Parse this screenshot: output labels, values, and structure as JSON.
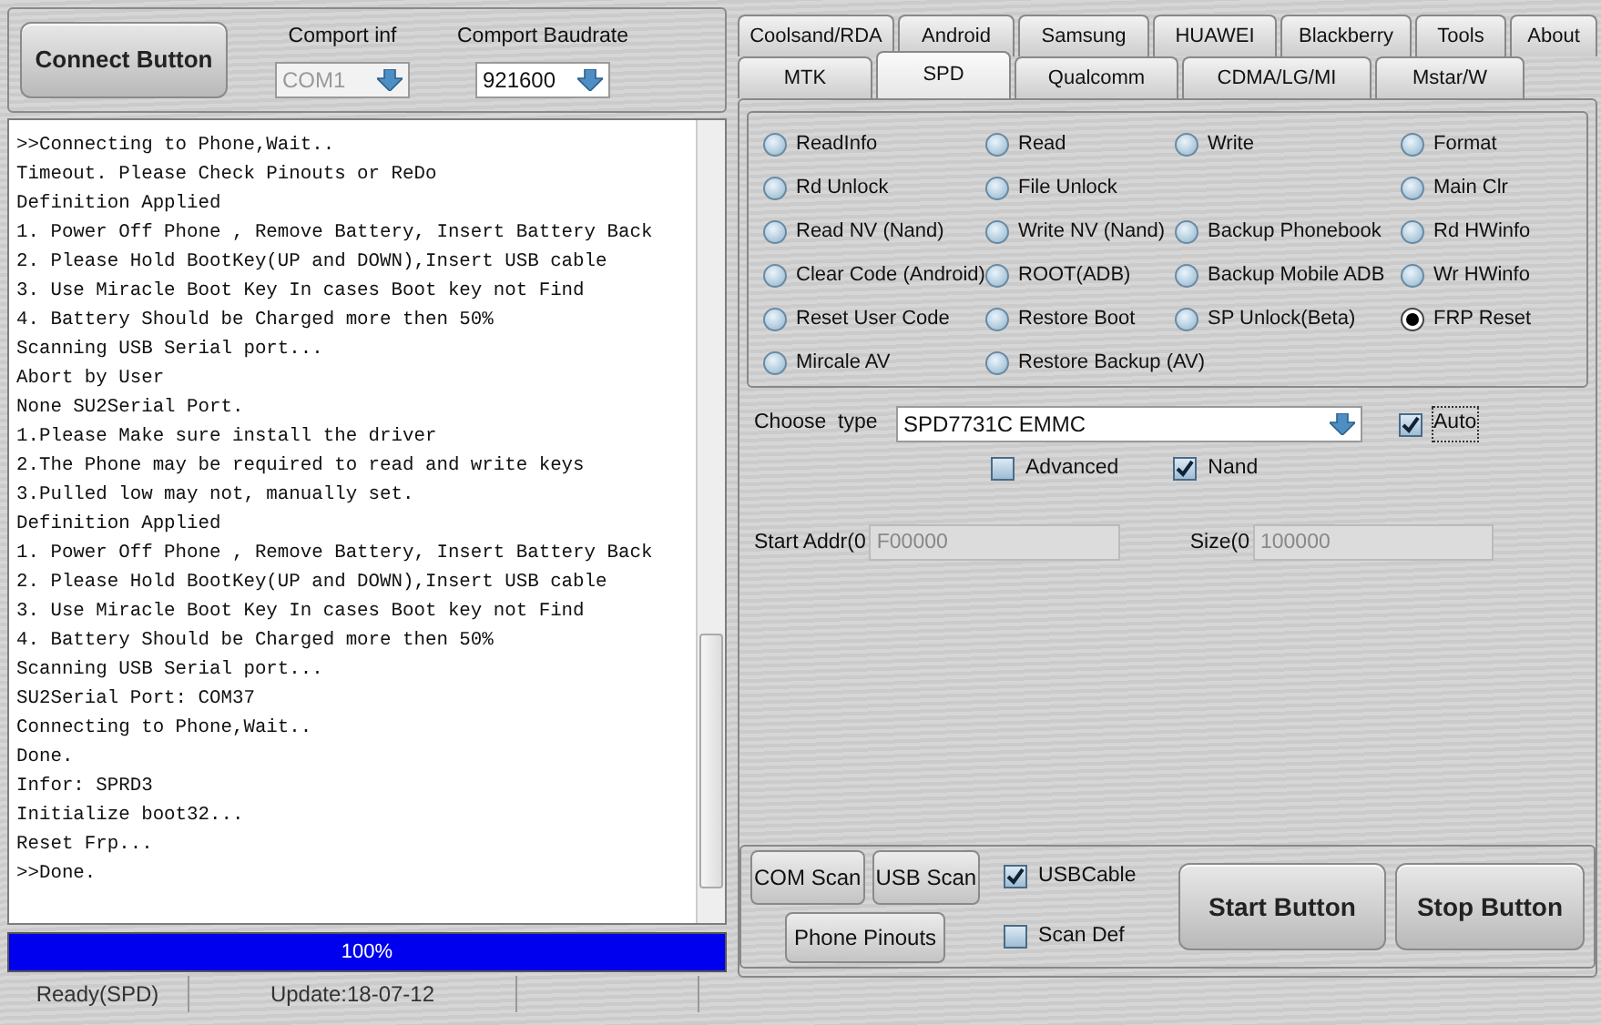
{
  "connect_button": "Connect Button",
  "comport": {
    "label": "Comport inf",
    "value": "COM1",
    "disabled": true
  },
  "baudrate": {
    "label": "Comport Baudrate",
    "value": "921600",
    "disabled": false
  },
  "log": [
    ">>Connecting to Phone,Wait..",
    "Timeout. Please Check Pinouts or ReDo",
    "Definition Applied",
    "1. Power Off Phone , Remove Battery, Insert Battery Back",
    "2. Please Hold BootKey(UP and DOWN),Insert USB cable",
    "3. Use Miracle Boot Key In cases Boot key not Find",
    "4. Battery Should be Charged more then 50%",
    "Scanning USB Serial port...",
    "Abort by User",
    "None SU2Serial Port.",
    "1.Please Make sure install the driver",
    "2.The Phone may be required to read and write keys",
    "3.Pulled low may not, manually set.",
    "Definition Applied",
    "1. Power Off Phone , Remove Battery, Insert Battery Back",
    "2. Please Hold BootKey(UP and DOWN),Insert USB cable",
    "3. Use Miracle Boot Key In cases Boot key not Find",
    "4. Battery Should be Charged more then 50%",
    "Scanning USB Serial port...",
    "SU2Serial Port: COM37",
    "Connecting to Phone,Wait..",
    "Done.",
    "Infor: SPRD3",
    "Initialize boot32...",
    "Reset Frp...",
    ">>Done."
  ],
  "progress": {
    "level": 1.0,
    "reading": "100%"
  },
  "status_bar": [
    "Ready(SPD)",
    "Update:18-07-12"
  ],
  "tab_rows": [
    [
      {
        "label": "Coolsand/RDA",
        "selected": false
      },
      {
        "label": "Android",
        "selected": false
      },
      {
        "label": "Samsung",
        "selected": false
      },
      {
        "label": "HUAWEI",
        "selected": false
      },
      {
        "label": "Blackberry",
        "selected": false
      },
      {
        "label": "Tools",
        "selected": false
      },
      {
        "label": "About",
        "selected": false
      }
    ],
    [
      {
        "label": "MTK",
        "selected": false
      },
      {
        "label": "SPD",
        "selected": true
      },
      {
        "label": "Qualcomm",
        "selected": false
      },
      {
        "label": "CDMA/LG/MI",
        "selected": false
      },
      {
        "label": "Mstar/W",
        "selected": false
      }
    ]
  ],
  "options": [
    {
      "kind": "radio",
      "label": "ReadInfo",
      "selected": false
    },
    {
      "kind": "radio",
      "label": "Read",
      "selected": false
    },
    {
      "kind": "radio",
      "label": "Write",
      "selected": false
    },
    {
      "kind": "radio",
      "label": "Format",
      "selected": false
    },
    {
      "kind": "radio",
      "label": "Rd Unlock",
      "selected": false
    },
    {
      "kind": "radio",
      "label": "File Unlock",
      "selected": false
    },
    {
      "kind": "blank"
    },
    {
      "kind": "radio",
      "label": "Main Clr",
      "selected": false
    },
    {
      "kind": "radio",
      "label": "Read NV (Nand)",
      "selected": false
    },
    {
      "kind": "radio",
      "label": "Write NV (Nand)",
      "selected": false
    },
    {
      "kind": "radio",
      "label": "Backup Phonebook",
      "selected": false
    },
    {
      "kind": "radio",
      "label": "Rd HWinfo",
      "selected": false
    },
    {
      "kind": "radio",
      "label": "Clear Code (Android)",
      "selected": false
    },
    {
      "kind": "radio",
      "label": "ROOT(ADB)",
      "selected": false
    },
    {
      "kind": "radio",
      "label": "Backup Mobile ADB",
      "selected": false
    },
    {
      "kind": "radio",
      "label": "Wr HWinfo",
      "selected": false
    },
    {
      "kind": "radio",
      "label": "Reset User Code",
      "selected": false
    },
    {
      "kind": "radio",
      "label": "Restore Boot",
      "selected": false
    },
    {
      "kind": "radio",
      "label": "SP Unlock(Beta)",
      "selected": false
    },
    {
      "kind": "radio",
      "label": "FRP Reset",
      "selected": true
    },
    {
      "kind": "radio",
      "label": "Mircale AV",
      "selected": false
    },
    {
      "kind": "radio",
      "label": "Restore Backup (AV)",
      "selected": false
    }
  ],
  "choose_type": {
    "label": "Choose  type",
    "value": "SPD7731C EMMC"
  },
  "auto": {
    "label": "Auto",
    "checked": true
  },
  "advanced": {
    "label": "Advanced",
    "checked": false
  },
  "nand": {
    "label": "Nand",
    "checked": true
  },
  "start_addr": {
    "label": "Start Addr(0",
    "value": "F00000",
    "disabled": true
  },
  "size": {
    "label": "Size(0",
    "value": "100000",
    "disabled": true
  },
  "scan_buttons": [
    "COM Scan",
    "USB Scan",
    "Phone Pinouts"
  ],
  "usb_cable": {
    "label": "USBCable",
    "checked": true
  },
  "scan_def": {
    "label": "Scan Def",
    "checked": false
  },
  "start_button": "Start Button",
  "stop_button": "Stop Button"
}
